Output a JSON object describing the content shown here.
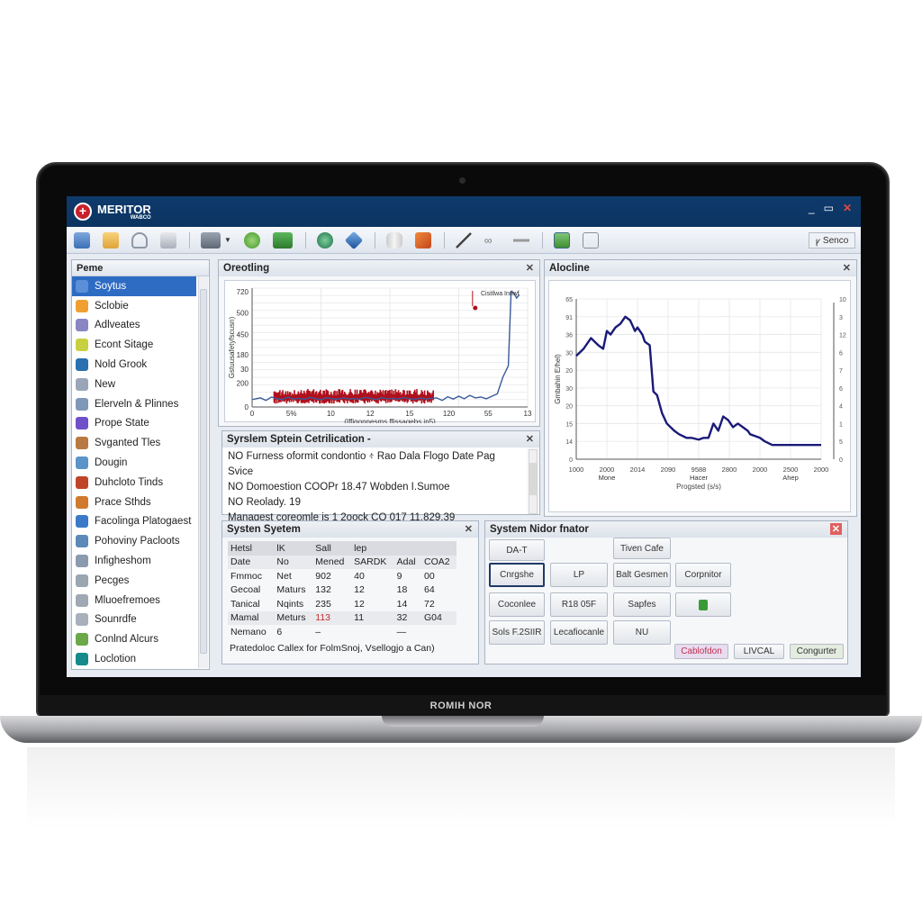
{
  "window": {
    "brand_name": "MERITOR",
    "brand_sub": "WABCO",
    "controls": {
      "minimize": "_",
      "restore": "▭",
      "close": "✕"
    }
  },
  "toolbar": {
    "icons": [
      "home-icon",
      "folder-icon",
      "user-icon",
      "document-icon",
      "printer-icon",
      "tree-icon",
      "monitor-icon",
      "network-icon",
      "gem-icon",
      "cylinder-icon",
      "tools-icon",
      "wrench-icon",
      "link-icon",
      "minus-icon",
      "photo-icon",
      "clipboard-icon"
    ],
    "search_label": "Senco",
    "search_icon": "ꝩ"
  },
  "sidebar": {
    "header": "Peme",
    "items": [
      {
        "label": "Soytus",
        "icon": "system-icon",
        "color": "#5b8fd8",
        "selected": true
      },
      {
        "label": "Sclobie",
        "icon": "warning-icon",
        "color": "#f0a030"
      },
      {
        "label": "Adlveates",
        "icon": "flask-icon",
        "color": "#8a86c4"
      },
      {
        "label": "Econt Sitage",
        "icon": "bulb-icon",
        "color": "#c8d040"
      },
      {
        "label": "Nold Grook",
        "icon": "book-icon",
        "color": "#2a6fb0"
      },
      {
        "label": "New",
        "icon": "gauge-icon",
        "color": "#9aa6b8"
      },
      {
        "label": "Elerveln & Plinnes",
        "icon": "panel-icon",
        "color": "#7f98b8"
      },
      {
        "label": "Prope State",
        "icon": "globe-icon",
        "color": "#7050c8"
      },
      {
        "label": "Svganted Tles",
        "icon": "stamp-icon",
        "color": "#b87a40"
      },
      {
        "label": "Dougin",
        "icon": "cloud-icon",
        "color": "#5a94c8"
      },
      {
        "label": "Duhcloto Tinds",
        "icon": "engine-icon",
        "color": "#c04428"
      },
      {
        "label": "Prace Sthds",
        "icon": "bottle-icon",
        "color": "#d07a30"
      },
      {
        "label": "Facolinga Platogaest",
        "icon": "anchor-icon",
        "color": "#3a7ac8"
      },
      {
        "label": "Pohoviny Pacloots",
        "icon": "box-icon",
        "color": "#5b8ab8"
      },
      {
        "label": "Infigheshom",
        "icon": "frame-icon",
        "color": "#8c9aae"
      },
      {
        "label": "Pecges",
        "icon": "house-icon",
        "color": "#9aa6b0"
      },
      {
        "label": "Mluoefremoes",
        "icon": "chat-icon",
        "color": "#a0a8b4"
      },
      {
        "label": "Sounrdfe",
        "icon": "keyboard-icon",
        "color": "#a8b0bc"
      },
      {
        "label": "Conlnd Alcurs",
        "icon": "tray-icon",
        "color": "#6aa84a"
      },
      {
        "label": "Loclotion",
        "icon": "location-icon",
        "color": "#168a8a"
      }
    ]
  },
  "panels": {
    "chart1_title": "Oreotling",
    "chart2_title": "Alocline",
    "log": {
      "title": "Syrslem Sptein Cetrilication -",
      "lines": [
        "NO Furness oformit condontio ፥ Rao Dala Flogo Date Pag Svice",
        "NO Domoestion COOPr 18.47 Wobden I.Sumoe",
        "NO Reolady. 19",
        "Managest coreomle is 1 2oock CO 017 11.829.39"
      ]
    },
    "system_table": {
      "title": "Systen Syetem",
      "header": [
        "Hetsl",
        "lK",
        "Sall",
        "lep",
        "",
        ""
      ],
      "rows": [
        [
          "Date",
          "No",
          "Mened",
          "SARDK",
          "Adal",
          "COA2"
        ],
        [
          "Fmmoc",
          "Net",
          "902",
          "40",
          "9",
          "00"
        ],
        [
          "Gecoal",
          "Maturs",
          "132",
          "12",
          "18",
          "64"
        ],
        [
          "Tanical",
          "Nqints",
          "235",
          "12",
          "14",
          "72"
        ],
        [
          "Mamal",
          "Meturs",
          "113",
          "11",
          "32",
          "G04"
        ],
        [
          "Nemano",
          "6",
          "–",
          "",
          "—",
          ""
        ]
      ],
      "footer": "Pratedoloc Callex for FolmSnoj, Vsellogjo a Can)"
    },
    "monitor": {
      "title": "System Nidor fnator",
      "buttons": [
        "DA-T",
        "Tiven Cafe",
        "Cnrgshe",
        "LP",
        "Balt Gesmen",
        "Corpnitor",
        "Coconlee",
        "R18 05F",
        "Sapfes",
        "",
        "Sols F.2SIIR",
        "Lecafiocanle",
        "NU"
      ],
      "footer_buttons": [
        "Cablofdon",
        "LIVCAL",
        "Congurter"
      ]
    }
  },
  "laptop_brand": "ROMIH NOR",
  "chart_data": [
    {
      "type": "line",
      "title": "Oreotling",
      "xlabel": "(Iffigonnesms ffissagebs in5)",
      "ylabel": "Gstuusafetyfscusn)",
      "y_tick_labels": [
        "0",
        "200",
        "30",
        "180",
        "450",
        "500",
        "720"
      ],
      "x_tick_labels": [
        "0",
        "5%",
        "10",
        "12",
        "15",
        "120",
        "55",
        "13"
      ],
      "ylim": [
        0,
        720
      ],
      "xlim": [
        0,
        100
      ],
      "legend": {
        "label": "Cisitlwa Inrlwf",
        "position": "top-right",
        "color": "#b0101c"
      },
      "series": [
        {
          "name": "signal",
          "color": "#3a5a9a",
          "x": [
            0,
            3,
            5,
            7,
            9,
            11,
            13,
            15,
            17,
            19,
            21,
            23,
            25,
            27,
            29,
            31,
            33,
            35,
            37,
            39,
            41,
            43,
            45,
            47,
            49,
            51,
            53,
            55,
            57,
            59,
            61,
            63,
            65,
            67,
            69,
            71,
            73,
            75,
            77,
            79,
            81,
            83,
            85,
            87,
            89,
            91,
            93,
            94,
            95,
            96,
            97
          ],
          "y": [
            45,
            55,
            40,
            60,
            50,
            45,
            60,
            48,
            52,
            46,
            58,
            50,
            44,
            56,
            50,
            47,
            55,
            49,
            51,
            46,
            58,
            52,
            45,
            56,
            49,
            53,
            47,
            57,
            50,
            46,
            54,
            48,
            52,
            55,
            40,
            62,
            48,
            65,
            50,
            70,
            55,
            60,
            50,
            65,
            80,
            180,
            250,
            700,
            690,
            660,
            680
          ]
        },
        {
          "name": "noise band",
          "color": "#b0101c",
          "x_range": [
            8,
            66
          ],
          "y_range": [
            20,
            110
          ]
        }
      ]
    },
    {
      "type": "line",
      "title": "Alocline",
      "xlabel": "Progsted (s/s)",
      "ylabel": "Gmbahin E/hel)",
      "x_tick_labels": [
        "1000",
        "2000",
        "2014",
        "2090",
        "9588",
        "2800",
        "2000",
        "2500",
        "2000"
      ],
      "x_sub_labels": {
        "2000": "Mone",
        "9588": "Hacer",
        "2500": "Ahep"
      },
      "y_tick_labels": [
        "0",
        "14",
        "15",
        "20",
        "30",
        "20",
        "30",
        "36",
        "91",
        "65"
      ],
      "y2_tick_labels": [
        "0",
        "5",
        "1",
        "4",
        "6",
        "7",
        "6",
        "12",
        "3",
        "10"
      ],
      "ylim": [
        0,
        45
      ],
      "xlim": [
        0,
        100
      ],
      "series": [
        {
          "name": "value",
          "color": "#1a1a78",
          "x": [
            0,
            3,
            6,
            9,
            11,
            12.5,
            14,
            16,
            18,
            20,
            22,
            24,
            25,
            27,
            28,
            30,
            31.5,
            33,
            35,
            37,
            40,
            42,
            45,
            47,
            50,
            52,
            54,
            56,
            58,
            60,
            62,
            64,
            66,
            68,
            70,
            71,
            73,
            75,
            77,
            80,
            83,
            85,
            88,
            91,
            94,
            97,
            100
          ],
          "y": [
            29,
            31,
            34,
            32,
            31,
            36,
            35,
            37,
            38,
            40,
            39,
            36,
            37,
            35,
            33,
            32,
            19,
            18,
            13,
            10,
            8,
            7,
            6,
            6,
            5.5,
            6,
            6,
            10,
            8,
            12,
            11,
            9,
            10,
            9,
            8,
            7,
            6.5,
            6,
            5,
            4,
            4,
            4,
            4,
            4,
            4,
            4,
            4
          ]
        }
      ]
    }
  ]
}
